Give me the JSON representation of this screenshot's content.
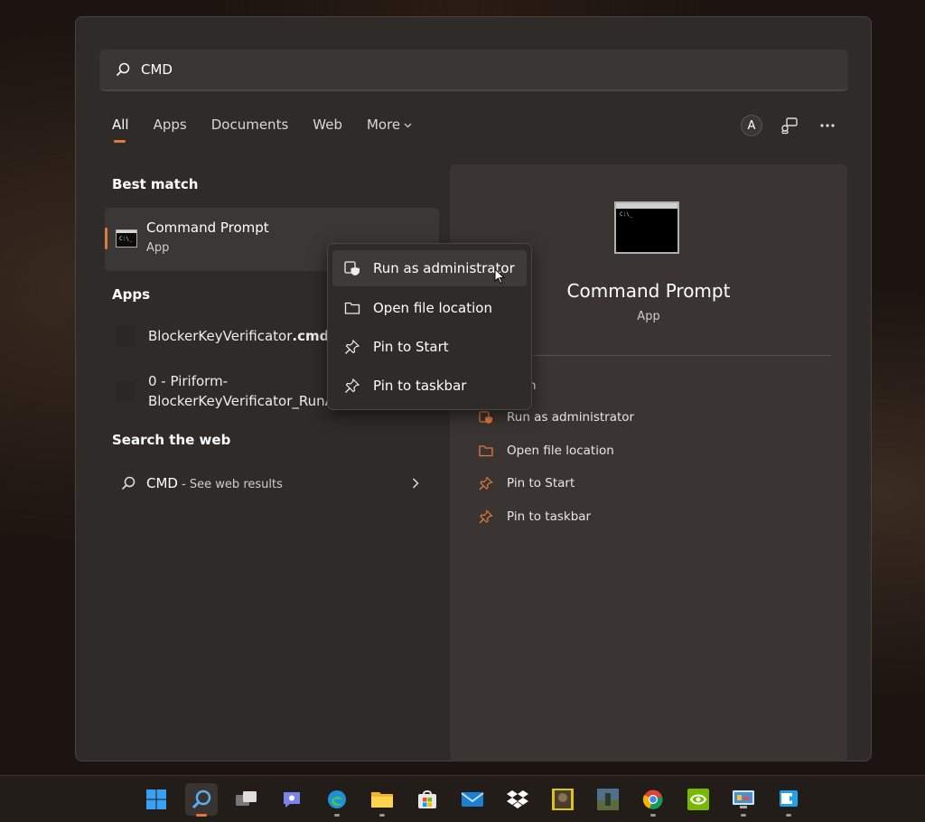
{
  "search": {
    "query": "CMD"
  },
  "filters": [
    {
      "label": "All",
      "active": true
    },
    {
      "label": "Apps"
    },
    {
      "label": "Documents"
    },
    {
      "label": "Web"
    },
    {
      "label": "More"
    }
  ],
  "header_right": {
    "avatar_letter": "A"
  },
  "best_match": {
    "section": "Best match",
    "title": "Command Prompt",
    "subtitle": "App"
  },
  "apps": {
    "section": "Apps",
    "items": [
      {
        "name": "BlockerKeyVerificator",
        "ext": ".cmd"
      },
      {
        "line1": "0 - Piriform-",
        "line2": "BlockerKeyVerificator_RunAs"
      }
    ]
  },
  "web": {
    "section": "Search the web",
    "query": "CMD",
    "suffix": " - See web results"
  },
  "context_menu": {
    "items": [
      {
        "label": "Run as administrator",
        "icon": "shield-admin-icon"
      },
      {
        "label": "Open file location",
        "icon": "folder-icon"
      },
      {
        "label": "Pin to Start",
        "icon": "pin-icon"
      },
      {
        "label": "Pin to taskbar",
        "icon": "pin-icon"
      }
    ]
  },
  "details": {
    "title": "Command Prompt",
    "subtitle": "App",
    "partial_action": "n",
    "actions": [
      {
        "label": "Run as administrator",
        "icon": "shield-admin-icon"
      },
      {
        "label": "Open file location",
        "icon": "folder-icon"
      },
      {
        "label": "Pin to Start",
        "icon": "pin-icon"
      },
      {
        "label": "Pin to taskbar",
        "icon": "pin-icon"
      }
    ]
  },
  "colors": {
    "accent": "#e07a3c",
    "panel": "#2f2b29",
    "pane": "#3a3532"
  },
  "taskbar": {
    "icons": [
      "windows-start-icon",
      "search-icon",
      "task-view-icon",
      "teams-chat-icon",
      "edge-icon",
      "file-explorer-icon",
      "store-icon",
      "mail-icon",
      "dropbox-icon",
      "game-icon-1",
      "game-icon-2",
      "chrome-icon",
      "nvidia-icon",
      "control-panel-icon",
      "remote-app-icon"
    ]
  }
}
